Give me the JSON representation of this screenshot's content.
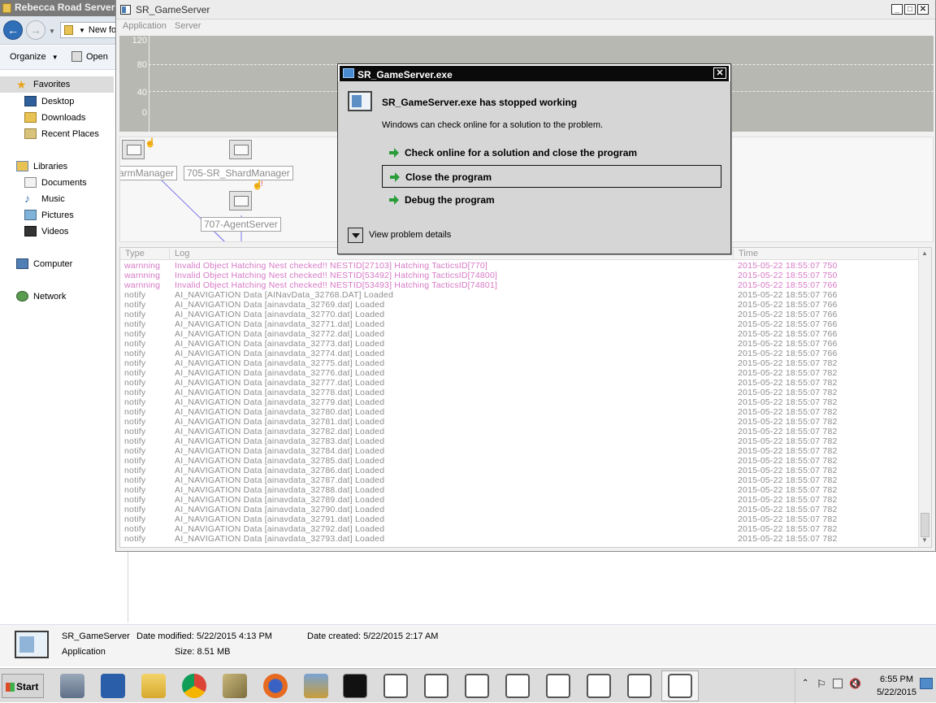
{
  "explorer": {
    "title": "Rebecca Road Server",
    "address": "New fo",
    "organize_label": "Organize",
    "open_label": "Open",
    "nav": {
      "favorites": "Favorites",
      "desktop": "Desktop",
      "downloads": "Downloads",
      "recent_places": "Recent Places",
      "libraries": "Libraries",
      "documents": "Documents",
      "music": "Music",
      "pictures": "Pictures",
      "videos": "Videos",
      "computer": "Computer",
      "network": "Network"
    },
    "details": {
      "name": "SR_GameServer",
      "type": "Application",
      "date_modified": "Date modified: 5/22/2015 4:13 PM",
      "size": "Size: 8.51 MB",
      "date_created": "Date created: 5/22/2015 2:17 AM"
    }
  },
  "server": {
    "title": "SR_GameServer",
    "menu": [
      "Application",
      "Server"
    ],
    "graph_labels": [
      "120",
      "80",
      "40",
      "0"
    ],
    "nodes": {
      "farm": "armManager",
      "shard": "705-SR_ShardManager",
      "agent": "707-AgentServer"
    },
    "log_headers": {
      "type": "Type",
      "log": "Log",
      "time": "Time"
    },
    "log_rows": [
      {
        "type": "warnning",
        "log": "Invalid Object Hatching Nest checked!! NESTID[27103] Hatching TacticsID[770]",
        "time": "2015-05-22 18:55:07 750",
        "warn": true
      },
      {
        "type": "warnning",
        "log": "Invalid Object Hatching Nest checked!! NESTID[53492] Hatching TacticsID[74800]",
        "time": "2015-05-22 18:55:07 750",
        "warn": true
      },
      {
        "type": "warnning",
        "log": "Invalid Object Hatching Nest checked!! NESTID[53493] Hatching TacticsID[74801]",
        "time": "2015-05-22 18:55:07 766",
        "warn": true
      },
      {
        "type": "notify",
        "log": "AI_NAVIGATION Data [AINavData_32768.DAT] Loaded",
        "time": "2015-05-22 18:55:07 766"
      },
      {
        "type": "notify",
        "log": "AI_NAVIGATION Data [ainavdata_32769.dat] Loaded",
        "time": "2015-05-22 18:55:07 766"
      },
      {
        "type": "notify",
        "log": "AI_NAVIGATION Data [ainavdata_32770.dat] Loaded",
        "time": "2015-05-22 18:55:07 766"
      },
      {
        "type": "notify",
        "log": "AI_NAVIGATION Data [ainavdata_32771.dat] Loaded",
        "time": "2015-05-22 18:55:07 766"
      },
      {
        "type": "notify",
        "log": "AI_NAVIGATION Data [ainavdata_32772.dat] Loaded",
        "time": "2015-05-22 18:55:07 766"
      },
      {
        "type": "notify",
        "log": "AI_NAVIGATION Data [ainavdata_32773.dat] Loaded",
        "time": "2015-05-22 18:55:07 766"
      },
      {
        "type": "notify",
        "log": "AI_NAVIGATION Data [ainavdata_32774.dat] Loaded",
        "time": "2015-05-22 18:55:07 766"
      },
      {
        "type": "notify",
        "log": "AI_NAVIGATION Data [ainavdata_32775.dat] Loaded",
        "time": "2015-05-22 18:55:07 782"
      },
      {
        "type": "notify",
        "log": "AI_NAVIGATION Data [ainavdata_32776.dat] Loaded",
        "time": "2015-05-22 18:55:07 782"
      },
      {
        "type": "notify",
        "log": "AI_NAVIGATION Data [ainavdata_32777.dat] Loaded",
        "time": "2015-05-22 18:55:07 782"
      },
      {
        "type": "notify",
        "log": "AI_NAVIGATION Data [ainavdata_32778.dat] Loaded",
        "time": "2015-05-22 18:55:07 782"
      },
      {
        "type": "notify",
        "log": "AI_NAVIGATION Data [ainavdata_32779.dat] Loaded",
        "time": "2015-05-22 18:55:07 782"
      },
      {
        "type": "notify",
        "log": "AI_NAVIGATION Data [ainavdata_32780.dat] Loaded",
        "time": "2015-05-22 18:55:07 782"
      },
      {
        "type": "notify",
        "log": "AI_NAVIGATION Data [ainavdata_32781.dat] Loaded",
        "time": "2015-05-22 18:55:07 782"
      },
      {
        "type": "notify",
        "log": "AI_NAVIGATION Data [ainavdata_32782.dat] Loaded",
        "time": "2015-05-22 18:55:07 782"
      },
      {
        "type": "notify",
        "log": "AI_NAVIGATION Data [ainavdata_32783.dat] Loaded",
        "time": "2015-05-22 18:55:07 782"
      },
      {
        "type": "notify",
        "log": "AI_NAVIGATION Data [ainavdata_32784.dat] Loaded",
        "time": "2015-05-22 18:55:07 782"
      },
      {
        "type": "notify",
        "log": "AI_NAVIGATION Data [ainavdata_32785.dat] Loaded",
        "time": "2015-05-22 18:55:07 782"
      },
      {
        "type": "notify",
        "log": "AI_NAVIGATION Data [ainavdata_32786.dat] Loaded",
        "time": "2015-05-22 18:55:07 782"
      },
      {
        "type": "notify",
        "log": "AI_NAVIGATION Data [ainavdata_32787.dat] Loaded",
        "time": "2015-05-22 18:55:07 782"
      },
      {
        "type": "notify",
        "log": "AI_NAVIGATION Data [ainavdata_32788.dat] Loaded",
        "time": "2015-05-22 18:55:07 782"
      },
      {
        "type": "notify",
        "log": "AI_NAVIGATION Data [ainavdata_32789.dat] Loaded",
        "time": "2015-05-22 18:55:07 782"
      },
      {
        "type": "notify",
        "log": "AI_NAVIGATION Data [ainavdata_32790.dat] Loaded",
        "time": "2015-05-22 18:55:07 782"
      },
      {
        "type": "notify",
        "log": "AI_NAVIGATION Data [ainavdata_32791.dat] Loaded",
        "time": "2015-05-22 18:55:07 782"
      },
      {
        "type": "notify",
        "log": "AI_NAVIGATION Data [ainavdata_32792.dat] Loaded",
        "time": "2015-05-22 18:55:07 782"
      },
      {
        "type": "notify",
        "log": "AI_NAVIGATION Data [ainavdata_32793.dat] Loaded",
        "time": "2015-05-22 18:55:07 782"
      }
    ]
  },
  "dialog": {
    "title": "SR_GameServer.exe",
    "heading": "SR_GameServer.exe has stopped working",
    "subtext": "Windows can check online for a solution to the problem.",
    "options": [
      "Check online for a solution and close the program",
      "Close the program",
      "Debug the program"
    ],
    "details_label": "View problem details",
    "close_glyph": "✕"
  },
  "taskbar": {
    "start_label": "Start",
    "time": "6:55 PM",
    "date": "5/22/2015",
    "icons": [
      "server-manager-icon",
      "powershell-icon",
      "explorer-icon",
      "chrome-icon",
      "tools-icon",
      "firefox-icon",
      "network-tool-icon",
      "cmd-icon",
      "app-icon",
      "app-icon",
      "app-icon",
      "app-icon",
      "app-icon",
      "app-icon",
      "app-icon",
      "app-icon"
    ]
  },
  "colors": {
    "warning_text": "#d778c6",
    "graph_bg": "#b7b8b1",
    "arrow_green": "#2a9d3a"
  }
}
